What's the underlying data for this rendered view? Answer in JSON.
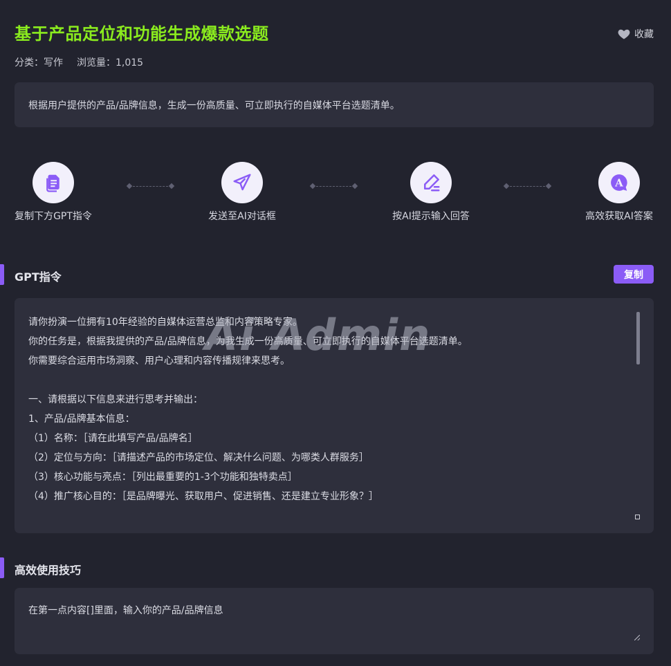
{
  "header": {
    "title": "基于产品定位和功能生成爆款选题",
    "favorite_label": "收藏",
    "category": "分类：写作",
    "views": "浏览量：1,015"
  },
  "description": "根据用户提供的产品/品牌信息，生成一份高质量、可立即执行的自媒体平台选题清单。",
  "steps": [
    {
      "label": "复制下方GPT指令",
      "icon": "document-copy-icon"
    },
    {
      "label": "发送至AI对话框",
      "icon": "paper-plane-icon"
    },
    {
      "label": "按AI提示输入回答",
      "icon": "pen-write-icon"
    },
    {
      "label": "高效获取AI答案",
      "icon": "ai-answer-icon"
    }
  ],
  "prompt_section": {
    "title": "GPT指令",
    "copy_label": "复制",
    "watermark": "Ai Admin",
    "lines": [
      "请你扮演一位拥有10年经验的自媒体运营总监和内容策略专家。",
      "你的任务是，根据我提供的产品/品牌信息，为我生成一份高质量、可立即执行的自媒体平台选题清单。",
      "你需要综合运用市场洞察、用户心理和内容传播规律来思考。",
      "",
      "一、请根据以下信息来进行思考并输出：",
      "1、产品/品牌基本信息：",
      "（1）名称：［请在此填写产品/品牌名］",
      "（2）定位与方向：［请描述产品的市场定位、解决什么问题、为哪类人群服务］",
      "（3）核心功能与亮点：［列出最重要的1-3个功能和独特卖点］",
      "（4）推广核心目的：［是品牌曝光、获取用户、促进销售、还是建立专业形象？］"
    ]
  },
  "tips_section": {
    "title": "高效使用技巧",
    "text": "在第一点内容[]里面，输入你的产品/品牌信息"
  },
  "colors": {
    "background": "#22232e",
    "panel": "#2e2f3c",
    "title": "#8bec1e",
    "accent": "#8b5cf6",
    "step_circle": "#f2f0fb"
  }
}
